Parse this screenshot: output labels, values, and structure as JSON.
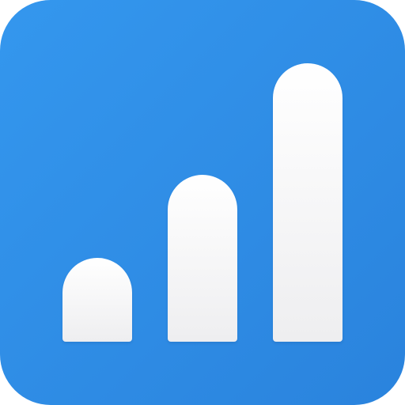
{
  "icon": {
    "name": "bar-chart-app-icon",
    "colors": {
      "background_top_left": "#3497EE",
      "background_bottom_right": "#2A83DD",
      "bar_top": "#FFFFFF",
      "bar_bottom": "#EEEEF0"
    },
    "bars": [
      {
        "level": 0.3
      },
      {
        "level": 0.6
      },
      {
        "level": 1.0
      }
    ]
  }
}
